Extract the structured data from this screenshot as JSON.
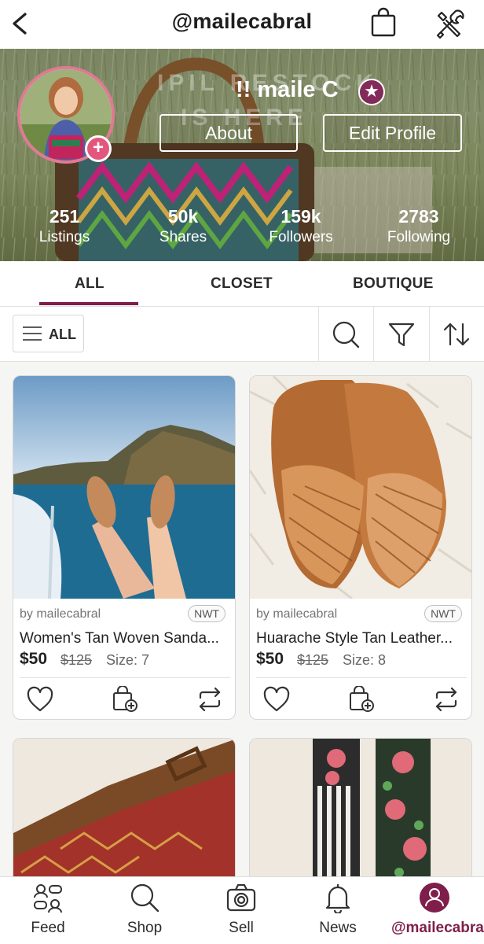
{
  "topbar": {
    "title": "@mailecabral"
  },
  "profile": {
    "cover_overlay_line1": "IPIL RESTOCK",
    "cover_overlay_line2": "IS HERE",
    "name": "!! maile C",
    "about_label": "About",
    "edit_label": "Edit Profile",
    "stats": [
      {
        "value": "251",
        "label": "Listings"
      },
      {
        "value": "50k",
        "label": "Shares"
      },
      {
        "value": "159k",
        "label": "Followers"
      },
      {
        "value": "2783",
        "label": "Following"
      }
    ]
  },
  "tabs": [
    {
      "label": "ALL",
      "active": true
    },
    {
      "label": "CLOSET",
      "active": false
    },
    {
      "label": "BOUTIQUE",
      "active": false
    }
  ],
  "filter": {
    "all_label": "ALL"
  },
  "listings": [
    {
      "by": "by mailecabral",
      "condition": "NWT",
      "title": "Women's Tan Woven Sanda...",
      "price": "$50",
      "original_price": "$125",
      "size": "Size: 7"
    },
    {
      "by": "by mailecabral",
      "condition": "NWT",
      "title": "Huarache Style Tan Leather...",
      "price": "$50",
      "original_price": "$125",
      "size": "Size: 8"
    }
  ],
  "bottom_nav": [
    {
      "label": "Feed",
      "icon": "feed-icon"
    },
    {
      "label": "Shop",
      "icon": "search-icon"
    },
    {
      "label": "Sell",
      "icon": "camera-icon"
    },
    {
      "label": "News",
      "icon": "bell-icon"
    },
    {
      "label": "@mailecabral",
      "icon": "profile-icon",
      "active": true
    }
  ],
  "colors": {
    "accent": "#7f1e4a",
    "badge_pink": "#e3577d",
    "avatar_ring": "#e07a93"
  }
}
